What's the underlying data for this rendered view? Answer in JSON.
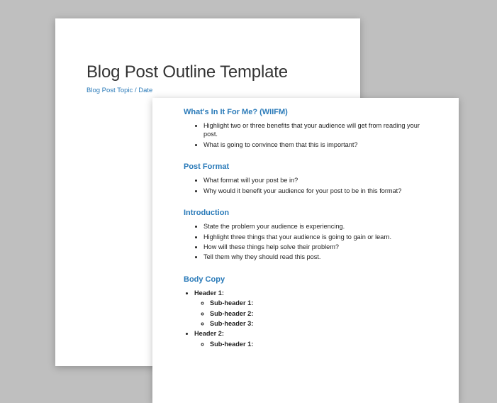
{
  "doc": {
    "title": "Blog Post Outline Template",
    "subtitle": "Blog Post Topic / Date"
  },
  "sections": {
    "wiifm": {
      "heading": "What's In It For Me? (WIIFM)",
      "items": [
        "Highlight two or three benefits that your audience will get from reading your post.",
        "What is going to convince them that this is important?"
      ]
    },
    "format": {
      "heading": "Post Format",
      "items": [
        "What format will your post be in?",
        "Why would it benefit your audience for your post to be in this format?"
      ]
    },
    "intro": {
      "heading": "Introduction",
      "items": [
        "State the problem your audience is experiencing.",
        "Highlight three things that your audience is going to gain or learn.",
        "How will these things help solve their problem?",
        "Tell them why they should read this post."
      ]
    },
    "body": {
      "heading": "Body Copy",
      "headers": [
        {
          "label": "Header 1:",
          "subs": [
            "Sub-header 1:",
            "Sub-header 2:",
            "Sub-header 3:"
          ]
        },
        {
          "label": "Header 2:",
          "subs": [
            "Sub-header 1:"
          ]
        }
      ]
    }
  }
}
